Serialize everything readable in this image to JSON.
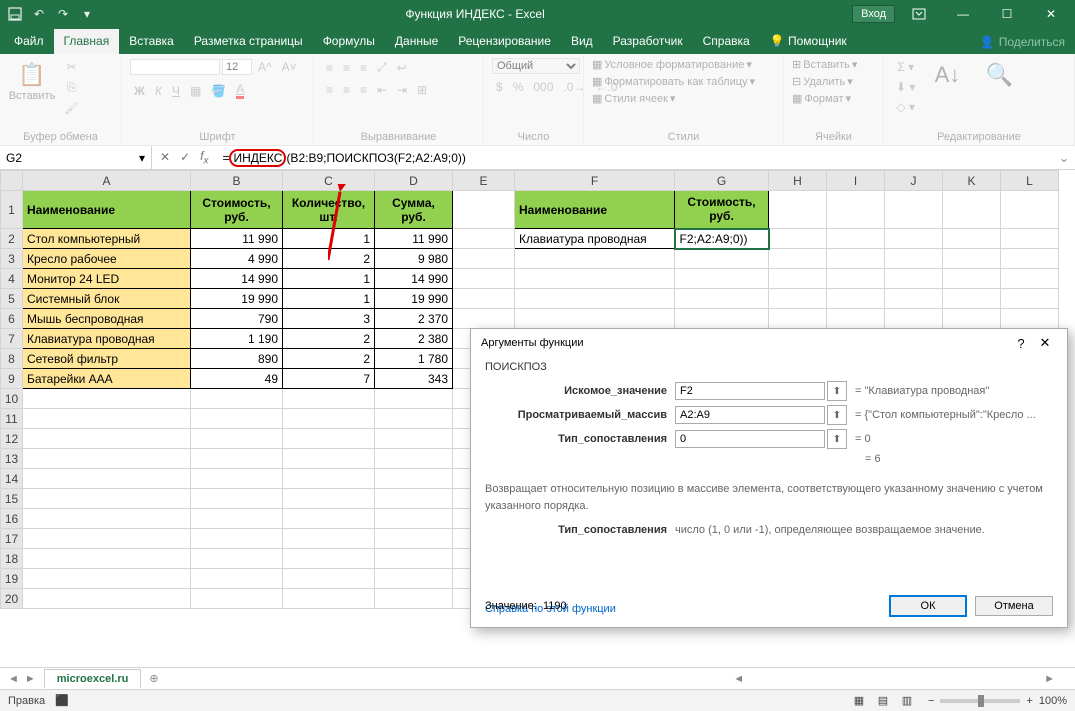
{
  "titlebar": {
    "title": "Функция ИНДЕКС - Excel",
    "login": "Вход"
  },
  "tabs": {
    "file": "Файл",
    "home": "Главная",
    "insert": "Вставка",
    "layout": "Разметка страницы",
    "formulas": "Формулы",
    "data": "Данные",
    "review": "Рецензирование",
    "view": "Вид",
    "developer": "Разработчик",
    "help": "Справка",
    "tellme": "Помощник",
    "share": "Поделиться"
  },
  "ribbon": {
    "paste": "Вставить",
    "groups": {
      "clipboard": "Буфер обмена",
      "font": "Шрифт",
      "align": "Выравнивание",
      "number": "Число",
      "styles": "Стили",
      "cells": "Ячейки",
      "editing": "Редактирование"
    },
    "fontsize": "12",
    "numfmt": "Общий",
    "b": "Ж",
    "i": "К",
    "u": "Ч",
    "condformat": "Условное форматирование",
    "astable": "Форматировать как таблицу",
    "cellstyles": "Стили ячеек",
    "insertc": "Вставить",
    "deletec": "Удалить",
    "formatc": "Формат"
  },
  "formula": {
    "name": "G2",
    "prefix": "=",
    "func": "ИНДЕКС",
    "rest": "(B2:B9;ПОИСКПОЗ(F2;A2:A9;0))"
  },
  "headers": {
    "name": "Наименование",
    "cost": "Стоимость, руб.",
    "qty": "Количество, шт.",
    "sum": "Сумма, руб."
  },
  "data": [
    {
      "name": "Стол компьютерный",
      "cost": "11 990",
      "qty": "1",
      "sum": "11 990"
    },
    {
      "name": "Кресло рабочее",
      "cost": "4 990",
      "qty": "2",
      "sum": "9 980"
    },
    {
      "name": "Монитор 24 LED",
      "cost": "14 990",
      "qty": "1",
      "sum": "14 990"
    },
    {
      "name": "Системный блок",
      "cost": "19 990",
      "qty": "1",
      "sum": "19 990"
    },
    {
      "name": "Мышь беспроводная",
      "cost": "790",
      "qty": "3",
      "sum": "2 370"
    },
    {
      "name": "Клавиатура проводная",
      "cost": "1 190",
      "qty": "2",
      "sum": "2 380"
    },
    {
      "name": "Сетевой фильтр",
      "cost": "890",
      "qty": "2",
      "sum": "1 780"
    },
    {
      "name": "Батарейки AAA",
      "cost": "49",
      "qty": "7",
      "sum": "343"
    }
  ],
  "lookup": {
    "name": "Клавиатура проводная",
    "result": "F2;A2:A9;0))"
  },
  "dialog": {
    "title": "Аргументы функции",
    "func": "ПОИСКПОЗ",
    "args": {
      "lookup": {
        "label": "Искомое_значение",
        "value": "F2",
        "result": "\"Клавиатура проводная\""
      },
      "array": {
        "label": "Просматриваемый_массив",
        "value": "A2:A9",
        "result": "{\"Стол компьютерный\":\"Кресло ..."
      },
      "type": {
        "label": "Тип_сопоставления",
        "value": "0",
        "result": "0"
      }
    },
    "fresult": "= 6",
    "desc": "Возвращает относительную позицию в массиве элемента, соответствующего указанному значению с учетом указанного порядка.",
    "argdesc_label": "Тип_сопоставления",
    "argdesc": "число (1, 0 или -1), определяющее возвращаемое значение.",
    "value_label": "Значение:",
    "value": "1190",
    "help": "Справка по этой функции",
    "ok": "ОК",
    "cancel": "Отмена"
  },
  "sheet": {
    "name": "microexcel.ru"
  },
  "status": {
    "mode": "Правка",
    "zoom": "100%"
  },
  "cols": [
    "A",
    "B",
    "C",
    "D",
    "E",
    "F",
    "G",
    "H",
    "I",
    "J",
    "K",
    "L"
  ]
}
